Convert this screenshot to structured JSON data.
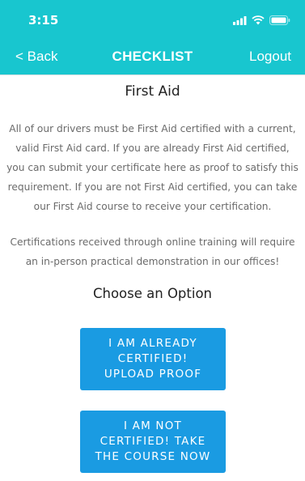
{
  "status_bar": {
    "time": "3:15",
    "icons": [
      "signal-icon",
      "wifi-icon",
      "battery-icon"
    ]
  },
  "nav": {
    "back_label": "< Back",
    "title": "CHECKLIST",
    "logout_label": "Logout"
  },
  "main": {
    "title": "First Aid",
    "paragraph_1": "All of our drivers must be First Aid certified with a current, valid First Aid card. If you are already First Aid certified, you can submit your certificate here as proof to satisfy this requirement. If you are not First Aid certified, you can take our First Aid course to receive your certification.",
    "paragraph_2": "Certifications received through online training will require an in-person practical demonstration in our offices!",
    "options_heading": "Choose an Option",
    "options": [
      {
        "label": "I AM ALREADY\nCERTIFIED!\nUPLOAD PROOF"
      },
      {
        "label": "I AM NOT\nCERTIFIED! TAKE\nTHE COURSE NOW"
      }
    ]
  },
  "colors": {
    "header": "#18c6cf",
    "button": "#1a9be2",
    "body_text": "#6b6b6b"
  }
}
